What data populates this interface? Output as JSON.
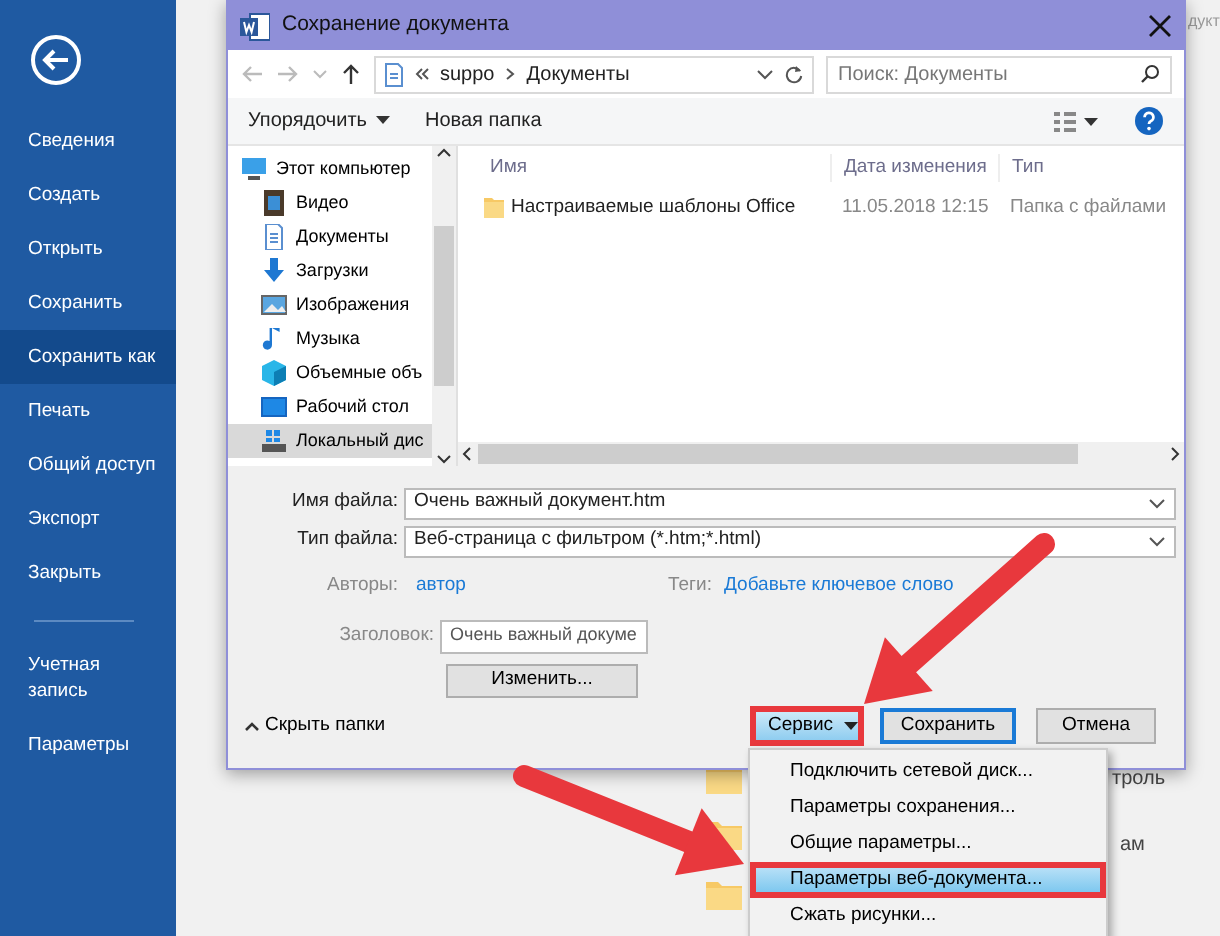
{
  "sidebar": {
    "groups": [
      [
        {
          "label": "Сведения",
          "selected": false
        },
        {
          "label": "Создать",
          "selected": false
        },
        {
          "label": "Открыть",
          "selected": false
        },
        {
          "label": "Сохранить",
          "selected": false
        },
        {
          "label": "Сохранить как",
          "selected": true
        },
        {
          "label": "Печать",
          "selected": false
        },
        {
          "label": "Общий доступ",
          "selected": false
        },
        {
          "label": "Экспорт",
          "selected": false
        },
        {
          "label": "Закрыть",
          "selected": false
        }
      ],
      [
        {
          "label": "Учетная запись",
          "selected": false
        },
        {
          "label": "Параметры",
          "selected": false
        }
      ]
    ]
  },
  "dialog": {
    "title": "Сохранение документа",
    "address": {
      "path": [
        "suppo",
        "Документы"
      ],
      "search_placeholder": "Поиск: Документы"
    },
    "toolbar": {
      "organize": "Упорядочить",
      "new_folder": "Новая папка"
    },
    "nav": [
      {
        "label": "Этот компьютер",
        "kind": "computer",
        "selected": false
      },
      {
        "label": "Видео",
        "kind": "video",
        "selected": false
      },
      {
        "label": "Документы",
        "kind": "documents",
        "selected": false
      },
      {
        "label": "Загрузки",
        "kind": "downloads",
        "selected": false
      },
      {
        "label": "Изображения",
        "kind": "images",
        "selected": false
      },
      {
        "label": "Музыка",
        "kind": "music",
        "selected": false
      },
      {
        "label": "Объемные объ",
        "kind": "objects",
        "selected": false
      },
      {
        "label": "Рабочий стол",
        "kind": "desktop",
        "selected": false
      },
      {
        "label": "Локальный дис",
        "kind": "disk",
        "selected": true
      }
    ],
    "columns": [
      "Имя",
      "Дата изменения",
      "Тип"
    ],
    "rows": [
      {
        "name": "Настраиваемые шаблоны Office",
        "date": "11.05.2018 12:15",
        "type": "Папка с файлами"
      }
    ],
    "file_name": {
      "label": "Имя файла:",
      "value": "Очень важный документ.htm"
    },
    "file_type": {
      "label": "Тип файла:",
      "value": "Веб-страница с фильтром (*.htm;*.html)"
    },
    "authors": {
      "label": "Авторы:",
      "value": "автор"
    },
    "tags": {
      "label": "Теги:",
      "value": "Добавьте ключевое слово"
    },
    "heading": {
      "label": "Заголовок:",
      "value": "Очень важный докуме"
    },
    "change_button": "Изменить...",
    "hide_folders": "Скрыть папки",
    "tools_button": {
      "label": "Сервис",
      "highlighted": true
    },
    "save_button": "Сохранить",
    "cancel_button": "Отмена"
  },
  "tools_menu": [
    {
      "label": "Подключить сетевой диск...",
      "selected": false
    },
    {
      "label": "Параметры сохранения...",
      "selected": false
    },
    {
      "label": "Общие параметры...",
      "selected": false
    },
    {
      "label": "Параметры веб-документа...",
      "selected": true
    },
    {
      "label": "Сжать рисунки...",
      "selected": false
    }
  ],
  "background": {
    "corner_text": "дукт",
    "texts": [
      "троль",
      "ам"
    ]
  }
}
